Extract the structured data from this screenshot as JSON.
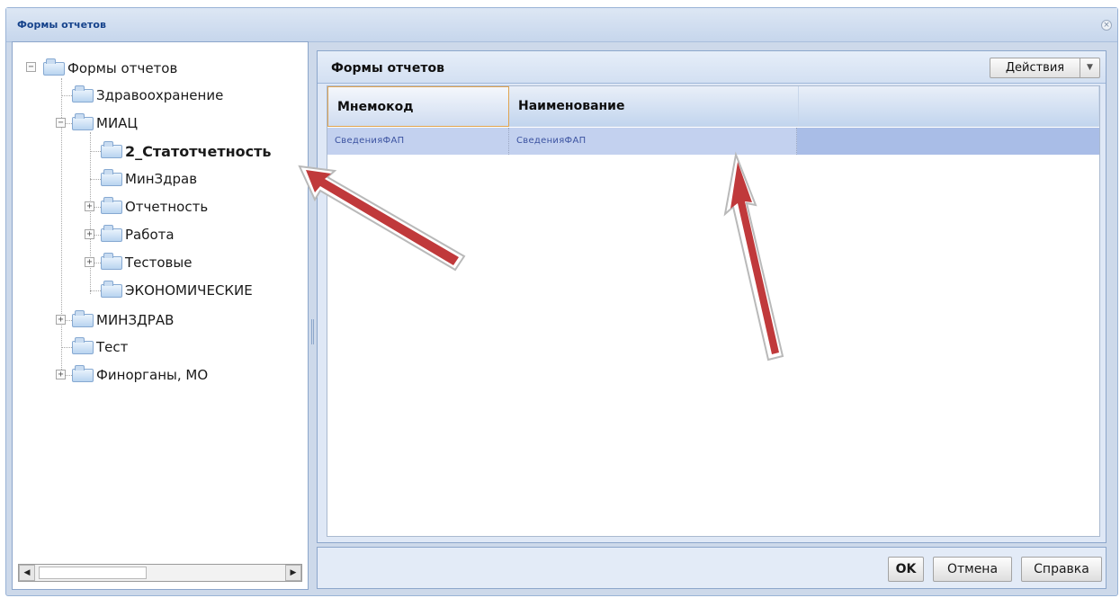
{
  "window": {
    "title": "Формы отчетов",
    "close_symbol": "×"
  },
  "tree": {
    "root": "Формы отчетов",
    "nodes": [
      "Здравоохранение",
      "МИАЦ",
      "2_Статотчетность",
      "МинЗдрав",
      "Отчетность",
      "Работа",
      "Тестовые",
      "ЭКОНОМИЧЕСКИЕ",
      "МИНЗДРАВ",
      "Тест",
      "Финорганы, МО"
    ],
    "expand_minus": "−",
    "expand_plus": "+",
    "scroll_left": "◀",
    "scroll_right": "▶"
  },
  "grid": {
    "title": "Формы отчетов",
    "actions_label": "Действия",
    "actions_dropdown": "▼",
    "columns": [
      "Мнемокод",
      "Наименование"
    ],
    "rows": [
      {
        "mnemocode": "СведенияФАП",
        "name": "СведенияФАП"
      }
    ]
  },
  "buttons": {
    "ok": "OK",
    "cancel": "Отмена",
    "help": "Справка"
  },
  "colors": {
    "titlebar_text": "#15428b",
    "selected_row": "#c3d1ef",
    "annotation_arrow": "#c0393b"
  }
}
